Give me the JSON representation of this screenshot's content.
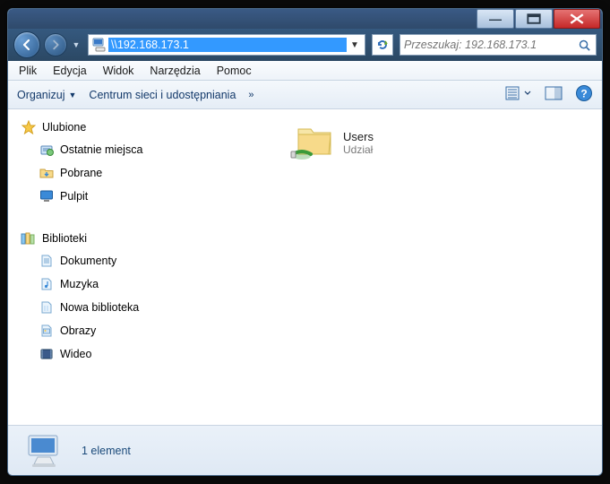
{
  "address": "\\\\192.168.173.1",
  "search_placeholder": "Przeszukaj: 192.168.173.1",
  "menu": {
    "file": "Plik",
    "edit": "Edycja",
    "view": "Widok",
    "tools": "Narzędzia",
    "help": "Pomoc"
  },
  "toolbar": {
    "organize": "Organizuj",
    "network_center": "Centrum sieci i udostępniania"
  },
  "tree": {
    "favorites": "Ulubione",
    "fav_items": {
      "recent": "Ostatnie miejsca",
      "downloads": "Pobrane",
      "desktop": "Pulpit"
    },
    "libraries": "Biblioteki",
    "lib_items": {
      "documents": "Dokumenty",
      "music": "Muzyka",
      "newlib": "Nowa biblioteka",
      "pictures": "Obrazy",
      "videos": "Wideo"
    }
  },
  "file_item": {
    "name": "Users",
    "sub": "Udział"
  },
  "status": "1 element"
}
